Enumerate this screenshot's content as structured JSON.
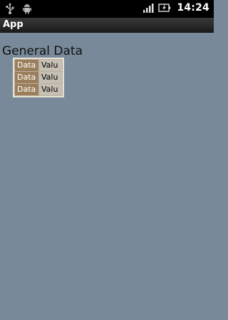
{
  "status_bar": {
    "time": "14:24",
    "icons": [
      "usb-icon",
      "android-debug-icon",
      "signal-icon",
      "battery-icon"
    ]
  },
  "app": {
    "title": "App"
  },
  "content": {
    "heading": "General Data",
    "rows": [
      {
        "key": "Data",
        "value": "Valu"
      },
      {
        "key": "Data",
        "value": "Valu"
      },
      {
        "key": "Data",
        "value": "Valu"
      }
    ]
  },
  "colors": {
    "background": "#788a99",
    "key_cell": "#9b7f5c",
    "value_cell": "#c5bfb4"
  }
}
